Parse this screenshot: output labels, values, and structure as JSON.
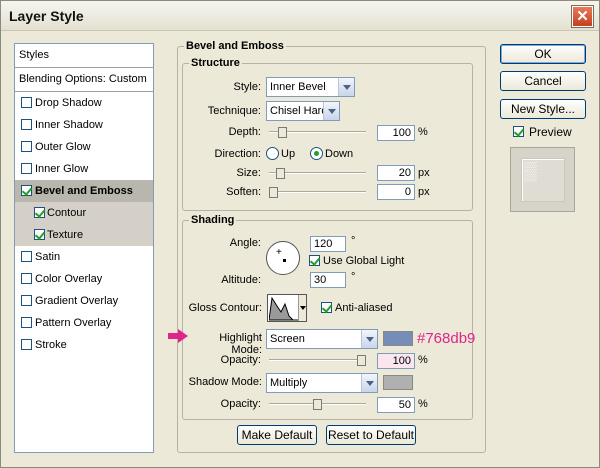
{
  "window": {
    "title": "Layer Style",
    "close_label": "✕"
  },
  "styles_panel": {
    "header": "Styles",
    "blending": "Blending Options: Custom",
    "items": [
      {
        "label": "Drop Shadow",
        "checked": false
      },
      {
        "label": "Inner Shadow",
        "checked": false
      },
      {
        "label": "Outer Glow",
        "checked": false
      },
      {
        "label": "Inner Glow",
        "checked": false
      },
      {
        "label": "Bevel and Emboss",
        "checked": true,
        "active": true
      },
      {
        "label": "Contour",
        "checked": true,
        "sub": true
      },
      {
        "label": "Texture",
        "checked": true,
        "sub": true
      },
      {
        "label": "Satin",
        "checked": false
      },
      {
        "label": "Color Overlay",
        "checked": false
      },
      {
        "label": "Gradient Overlay",
        "checked": false
      },
      {
        "label": "Pattern Overlay",
        "checked": false
      },
      {
        "label": "Stroke",
        "checked": false
      }
    ]
  },
  "bevel": {
    "title": "Bevel and Emboss",
    "structure_title": "Structure",
    "style_label": "Style:",
    "style_value": "Inner Bevel",
    "technique_label": "Technique:",
    "technique_value": "Chisel Hard",
    "depth_label": "Depth:",
    "depth_value": "100",
    "depth_unit": "%",
    "depth_level": 0.1,
    "direction_label": "Direction:",
    "up_label": "Up",
    "down_label": "Down",
    "direction_value": "Down",
    "size_label": "Size:",
    "size_value": "20",
    "size_unit": "px",
    "size_level": 0.08,
    "soften_label": "Soften:",
    "soften_value": "0",
    "soften_unit": "px",
    "soften_level": 0.0
  },
  "shading": {
    "title": "Shading",
    "angle_label": "Angle:",
    "angle_value": "120",
    "angle_unit": "°",
    "global_light_label": "Use Global Light",
    "global_light_checked": true,
    "altitude_label": "Altitude:",
    "altitude_value": "30",
    "altitude_unit": "°",
    "gloss_label": "Gloss Contour:",
    "anti_aliased_label": "Anti-aliased",
    "anti_aliased_checked": true,
    "highlight_label": "Highlight Mode:",
    "highlight_value": "Screen",
    "highlight_color": "#768db9",
    "hl_opacity_label": "Opacity:",
    "hl_opacity_value": "100",
    "hl_opacity_unit": "%",
    "hl_opacity_level": 1.0,
    "shadow_label": "Shadow Mode:",
    "shadow_value": "Multiply",
    "shadow_color": "#b0b0b0",
    "sh_opacity_label": "Opacity:",
    "sh_opacity_value": "50",
    "sh_opacity_unit": "%",
    "sh_opacity_level": 0.5
  },
  "buttons": {
    "make_default": "Make Default",
    "reset_default": "Reset to Default",
    "ok": "OK",
    "cancel": "Cancel",
    "new_style": "New Style...",
    "preview": "Preview",
    "preview_checked": true
  },
  "annotation": {
    "hex_label": "#768db9",
    "color": "#e0248d"
  }
}
